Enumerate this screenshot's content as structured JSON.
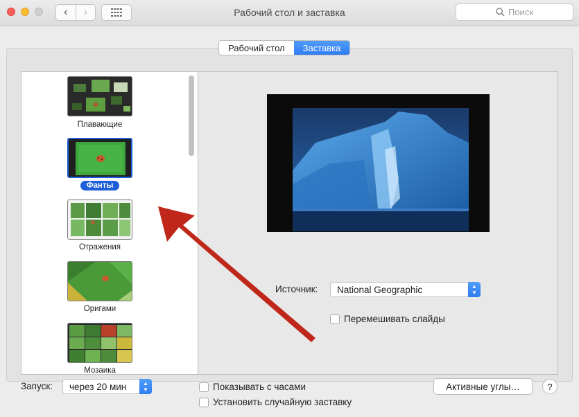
{
  "window": {
    "title": "Рабочий стол и заставка",
    "search_placeholder": "Поиск"
  },
  "tabs": [
    {
      "label": "Рабочий стол",
      "active": false
    },
    {
      "label": "Заставка",
      "active": true
    }
  ],
  "screensavers": [
    {
      "label": "Плавающие",
      "selected": false
    },
    {
      "label": "Фанты",
      "selected": true
    },
    {
      "label": "Отражения",
      "selected": false
    },
    {
      "label": "Оригами",
      "selected": false
    },
    {
      "label": "Мозаика",
      "selected": false
    }
  ],
  "options": {
    "source_label": "Источник:",
    "source_value": "National Geographic",
    "shuffle_label": "Перемешивать слайды",
    "shuffle_checked": false
  },
  "footer": {
    "start_label": "Запуск:",
    "start_value": "через 20 мин",
    "show_clock_label": "Показывать с часами",
    "show_clock_checked": false,
    "random_label": "Установить случайную заставку",
    "random_checked": false,
    "hot_corners_label": "Активные углы…",
    "help_label": "?"
  },
  "colors": {
    "accent": "#2f7df2",
    "annotation_arrow": "#c0271b"
  }
}
